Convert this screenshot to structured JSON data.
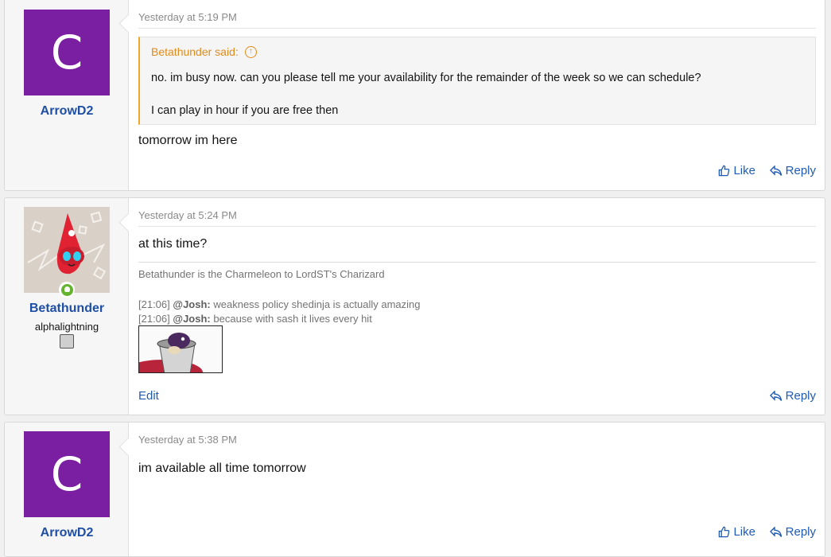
{
  "posts": [
    {
      "user": {
        "avatar_letter": "C",
        "username": "ArrowD2",
        "avatar_color": "#7b1fa2"
      },
      "timestamp": "Yesterday at 5:19 PM",
      "quote": {
        "author": "Betathunder said:",
        "lines": [
          "no. im busy now. can you please tell me your availability for the remainder of the week so we can schedule?",
          "I can play in hour if you are free then"
        ]
      },
      "message": "tomorrow im here",
      "actions": {
        "like": "Like",
        "reply": "Reply"
      }
    },
    {
      "user": {
        "username": "Betathunder",
        "user_title": "alphalightning",
        "online": true
      },
      "timestamp": "Yesterday at 5:24 PM",
      "message": "at this time?",
      "signature": {
        "line1": "Betathunder is the Charmeleon to LordST's Charizard",
        "chat": [
          {
            "time": "[21:06]",
            "nick": "@Josh:",
            "text": "weakness policy shedinja is actually amazing"
          },
          {
            "time": "[21:06]",
            "nick": "@Josh:",
            "text": "because with sash it lives every hit"
          }
        ]
      },
      "actions": {
        "edit": "Edit",
        "reply": "Reply"
      }
    },
    {
      "user": {
        "avatar_letter": "C",
        "username": "ArrowD2",
        "avatar_color": "#7b1fa2"
      },
      "timestamp": "Yesterday at 5:38 PM",
      "message": "im available all time tomorrow",
      "actions": {
        "like": "Like",
        "reply": "Reply"
      }
    }
  ],
  "colors": {
    "accent": "#1f5bb5",
    "quote_border": "#f0a52b",
    "online": "#63b32e"
  }
}
